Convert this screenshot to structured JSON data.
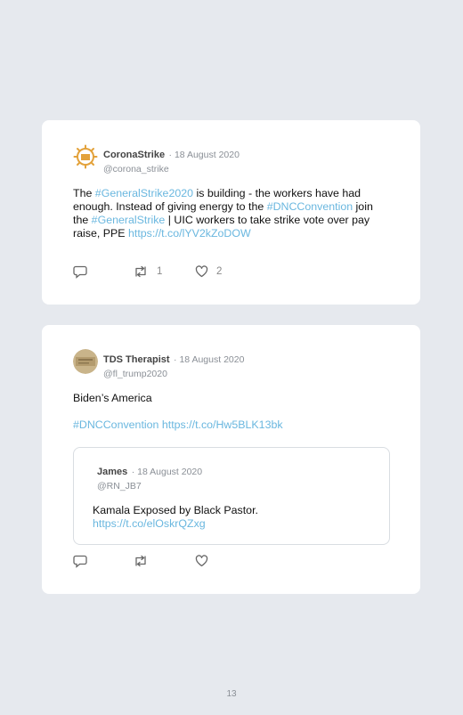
{
  "tweets": [
    {
      "name": "CoronaStrike",
      "date": "· 18 August 2020",
      "handle": "@corona_strike",
      "text": {
        "p1": "The ",
        "l1": "#GeneralStrike2020",
        "p2": " is building - the workers have had enough. Instead of giving energy to the ",
        "l2": "#DNCConvention",
        "p3": " join the ",
        "l3": "#GeneralStrike",
        "p4": " | UIC workers to take strike vote over pay raise, PPE ",
        "l4": "https://t.co/lYV2kZoDOW"
      },
      "retweets": "1",
      "likes": "2"
    },
    {
      "name": "TDS Therapist",
      "date": "· 18 August 2020",
      "handle": "@fl_trump2020",
      "text": {
        "line1": "Biden’s America",
        "l1": "#DNCConvention",
        "l2": "https://t.co/Hw5BLK13bk"
      },
      "quoted": {
        "name": "James",
        "date": "· 18 August 2020",
        "handle": "@RN_JB7",
        "text": "Kamala Exposed by Black Pastor.",
        "link": "https://t.co/elOskrQZxg"
      }
    }
  ],
  "colors": {
    "link": "#6ab7df",
    "background": "#e6e9ee",
    "card": "#ffffff"
  },
  "page_number": "13"
}
